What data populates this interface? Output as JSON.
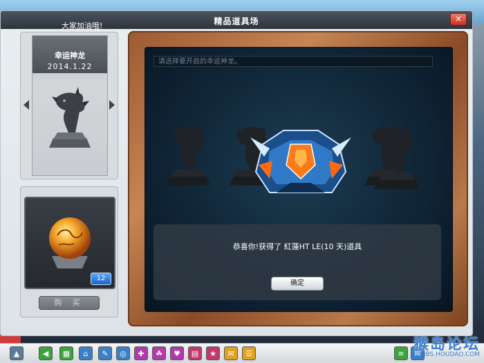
{
  "window": {
    "title": "精品道具场",
    "subtitle": "大家加油哦!",
    "close_label": "×"
  },
  "dragon": {
    "name": "幸运神龙",
    "date": "2014.1.22"
  },
  "item": {
    "count": "12",
    "buy_label": "购 买"
  },
  "stage": {
    "hint_placeholder": "请选择要开启的幸运神龙。",
    "result_message": "恭喜你!获得了 紅蓮HT LE(10 天)道具",
    "confirm_label": "确定"
  },
  "taskbar": {
    "icons": [
      {
        "name": "start-icon",
        "glyph": "▲",
        "color": "#5a7a9a"
      },
      {
        "name": "back-icon",
        "glyph": "◀",
        "color": "#3da33d"
      },
      {
        "name": "shop-icon",
        "glyph": "▦",
        "color": "#3da33d"
      },
      {
        "name": "home-icon",
        "glyph": "⌂",
        "color": "#3a7fc8"
      },
      {
        "name": "tool-icon",
        "glyph": "✎",
        "color": "#3a7fc8"
      },
      {
        "name": "club-icon",
        "glyph": "◎",
        "color": "#3a7fc8"
      },
      {
        "name": "gift-icon",
        "glyph": "✚",
        "color": "#b03aa8"
      },
      {
        "name": "team-icon",
        "glyph": "☘",
        "color": "#b03aa8"
      },
      {
        "name": "heart-icon",
        "glyph": "♥",
        "color": "#b03aa8"
      },
      {
        "name": "book-icon",
        "glyph": "▤",
        "color": "#c23a6a"
      },
      {
        "name": "star-icon",
        "glyph": "★",
        "color": "#c23a6a"
      },
      {
        "name": "chat-icon",
        "glyph": "✉",
        "color": "#e0a020"
      },
      {
        "name": "notice-icon",
        "glyph": "☰",
        "color": "#e0a020"
      },
      {
        "name": "list-icon",
        "glyph": "≡",
        "color": "#3da33d"
      },
      {
        "name": "mail-icon",
        "glyph": "✉",
        "color": "#3a7fc8"
      }
    ]
  },
  "watermark": {
    "brand": "猴岛论坛",
    "url": "BBS.HOUDAO.COM"
  }
}
